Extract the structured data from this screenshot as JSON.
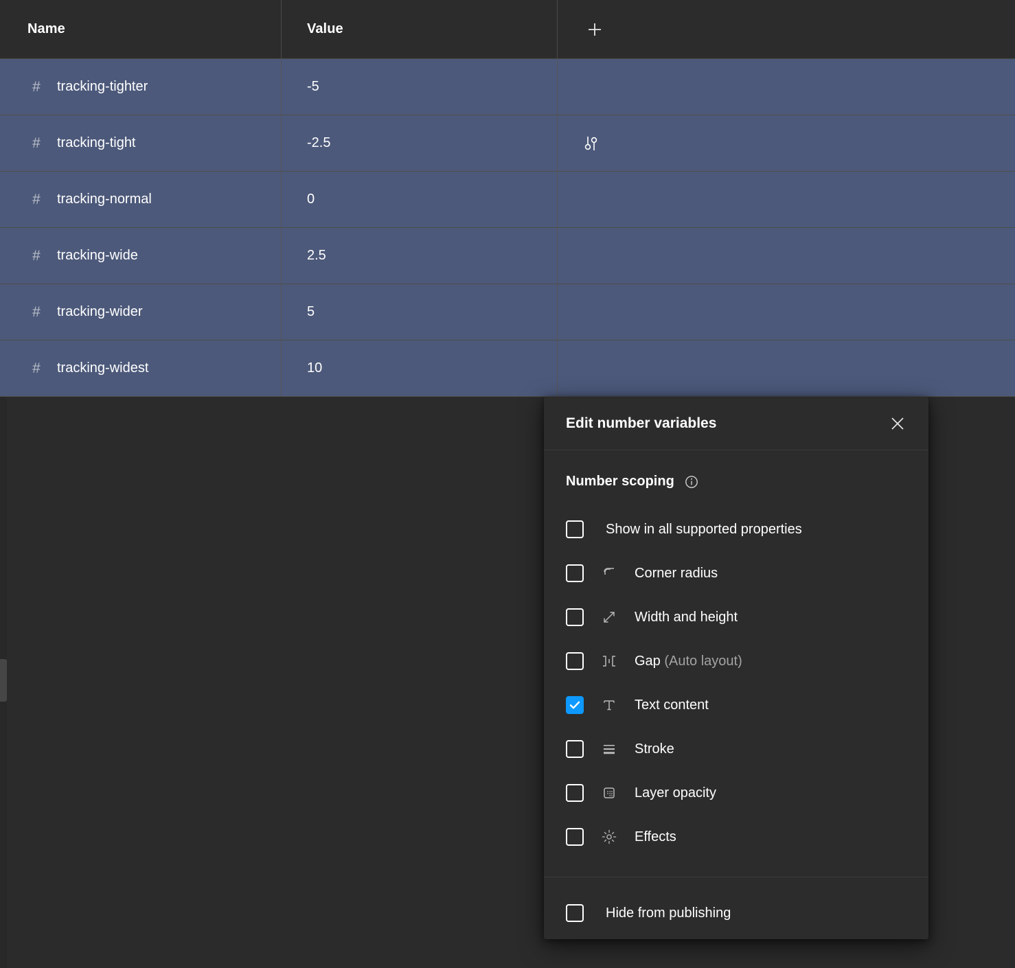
{
  "table": {
    "columns": [
      {
        "key": "name",
        "label": "Name"
      },
      {
        "key": "value",
        "label": "Value"
      },
      {
        "key": "add",
        "label": "",
        "icon": "plus-icon"
      }
    ],
    "add_button_icon": "plus-icon",
    "rows": [
      {
        "icon": "number-variable-hash-icon",
        "name": "tracking-tighter",
        "value": "-5",
        "extra_icon": ""
      },
      {
        "icon": "number-variable-hash-icon",
        "name": "tracking-tight",
        "value": "-2.5",
        "extra_icon": "sliders-icon"
      },
      {
        "icon": "number-variable-hash-icon",
        "name": "tracking-normal",
        "value": "0",
        "extra_icon": ""
      },
      {
        "icon": "number-variable-hash-icon",
        "name": "tracking-wide",
        "value": "2.5",
        "extra_icon": ""
      },
      {
        "icon": "number-variable-hash-icon",
        "name": "tracking-wider",
        "value": "5",
        "extra_icon": ""
      },
      {
        "icon": "number-variable-hash-icon",
        "name": "tracking-widest",
        "value": "10",
        "extra_icon": ""
      }
    ],
    "row_selected_color": "#4c597a",
    "header_color": "#2c2c2c"
  },
  "dialog": {
    "title": "Edit number variables",
    "close_icon": "close-icon",
    "section": {
      "title": "Number scoping",
      "info_icon": "info-icon"
    },
    "options": [
      {
        "label": "Show in all supported properties",
        "checked": false,
        "icon": ""
      },
      {
        "label": "Corner radius",
        "checked": false,
        "icon": "corner-radius-icon"
      },
      {
        "label": "Width and height",
        "checked": false,
        "icon": "width-height-icon"
      },
      {
        "label": "Gap",
        "suffix": " (Auto layout)",
        "checked": false,
        "icon": "gap-icon"
      },
      {
        "label": "Text content",
        "checked": true,
        "icon": "text-content-icon"
      },
      {
        "label": "Stroke",
        "checked": false,
        "icon": "stroke-icon"
      },
      {
        "label": "Layer opacity",
        "checked": false,
        "icon": "layer-opacity-icon"
      },
      {
        "label": "Effects",
        "checked": false,
        "icon": "effects-icon"
      }
    ],
    "footer": {
      "label": "Hide from publishing",
      "checked": false
    },
    "accent_color": "#0d99ff",
    "background_color": "#2c2c2c"
  }
}
